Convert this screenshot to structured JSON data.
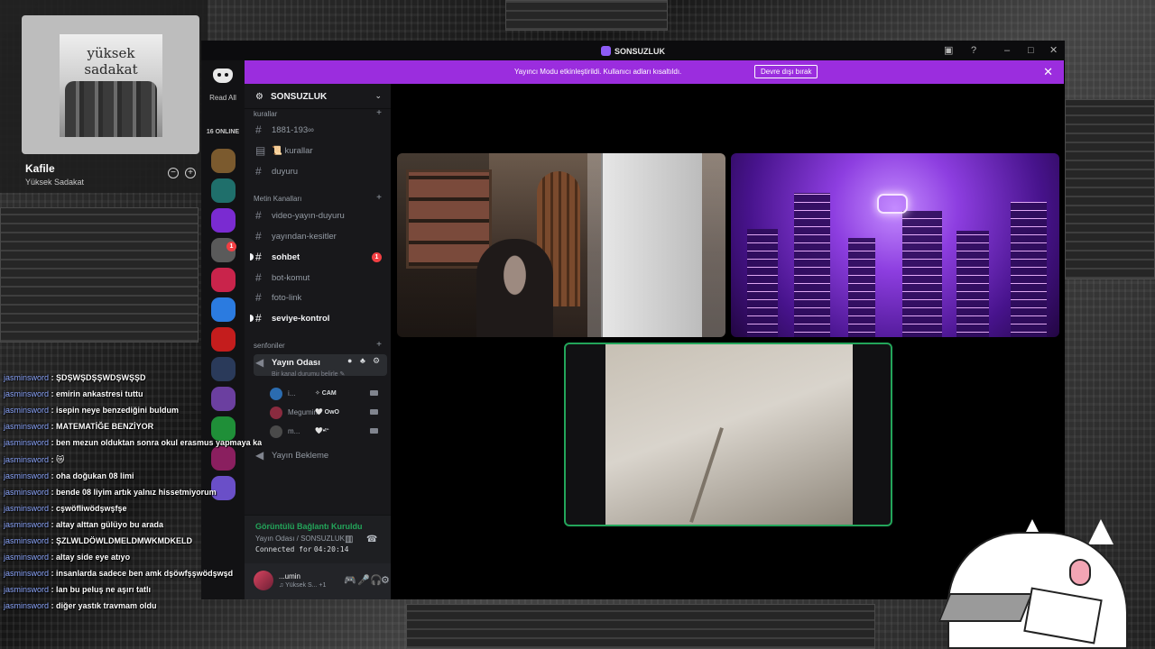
{
  "music": {
    "album_text": "yüksek sadakat",
    "track_title": "Kafile",
    "artist": "Yüksek Sadakat",
    "minus": "−",
    "plus": "+"
  },
  "window": {
    "title": "SONSUZLUK",
    "controls": [
      "▣",
      "?",
      "–",
      "□",
      "✕"
    ]
  },
  "banner": {
    "text": "Yayıncı Modu etkinleştirildi. Kullanıcı adları kısaltıldı.",
    "button_label": "Devre dışı bırak",
    "close": "✕"
  },
  "guilds": {
    "read_all": "Read All",
    "online": "16 ONLINE",
    "badge_1": "1",
    "icons": [
      "#7b5a2e",
      "#1f6f6b",
      "#7a2bd1",
      "#5a5a5a",
      "#c9244b",
      "#2b7be0",
      "#c41d1d",
      "#2a3a5a",
      "#6b3fa0",
      "#1f8f38",
      "#8a1f5f",
      "#6a4fc8"
    ]
  },
  "server": {
    "name": "SONSUZLUK",
    "logo": "⚙",
    "chevron": "⌄",
    "categories": {
      "rules": "kurallar",
      "text": "Metin Kanalları",
      "voice": "senfoniler"
    },
    "channels": {
      "c1881": "1881-193∞",
      "kurallar": "📜 kurallar",
      "duyuru": "duyuru",
      "video": "video-yayın-duyuru",
      "kesitler": "yayından-kesitler",
      "sohbet": "sohbet",
      "bot": "bot-komut",
      "foto": "foto-link",
      "seviye": "seviye-kontrol",
      "yayin_odasi": "Yayın Odası",
      "yayin_bekleme": "Yayın Bekleme"
    },
    "sohbet_badge": "1",
    "voice_status": "Bir kanal durumu belirle ✎",
    "voice_users": [
      {
        "name": "i...",
        "tag": "✧ CAM",
        "color": "#2b6cb0"
      },
      {
        "name": "Megumin",
        "tag": "🤍 OwO",
        "color": "#8a2b3f"
      },
      {
        "name": "m...",
        "tag": "🤍•ᵗᵔ",
        "color": "#4a4a4a"
      }
    ]
  },
  "rtc": {
    "status": "Görüntülü Bağlantı Kuruldu",
    "channel": "Yayın Odası / SONSUZLUK",
    "connected_label": "Connected for",
    "connected_time": "04:20:14",
    "buttons": [
      "▶",
      "🖥",
      "🎮",
      "✋"
    ]
  },
  "user": {
    "name": "...umin",
    "activity": "♫ Yüksek S... +1",
    "icons": [
      "🎮",
      "🎤",
      "🎧",
      "⚙"
    ]
  },
  "chat": [
    {
      "user": "jasminsword",
      "msg": "ŞDŞWŞDŞŞWDŞWŞŞD"
    },
    {
      "user": "jasminsword",
      "msg": "emirin ankastresi tuttu"
    },
    {
      "user": "jasminsword",
      "msg": "isepin neye benzediğini buldum"
    },
    {
      "user": "jasminsword",
      "msg": "MATEMATİĞE BENZİYOR"
    },
    {
      "user": "jasminsword",
      "msg": "ben mezun olduktan sonra okul erasmus yapmaya karar verdi"
    },
    {
      "user": "jasminsword",
      "msg": "😿"
    },
    {
      "user": "jasminsword",
      "msg": "oha doğukan 08 limi"
    },
    {
      "user": "jasminsword",
      "msg": "bende 08 liyim artık yalnız hissetmiyorum"
    },
    {
      "user": "jasminsword",
      "msg": "cşwöfliwödşwşfşe"
    },
    {
      "user": "jasminsword",
      "msg": "altay alttan gülüyo bu arada"
    },
    {
      "user": "jasminsword",
      "msg": "ŞZLWLDÖWLDMELDMWKMDKELD"
    },
    {
      "user": "jasminsword",
      "msg": "altay side eye atıyo"
    },
    {
      "user": "jasminsword",
      "msg": "insanlarda sadece ben amk dşöwfşşwödşwşd"
    },
    {
      "user": "jasminsword",
      "msg": "lan bu peluş ne aşırı tatlı"
    },
    {
      "user": "jasminsword",
      "msg": "diğer yastık travmam oldu"
    }
  ]
}
